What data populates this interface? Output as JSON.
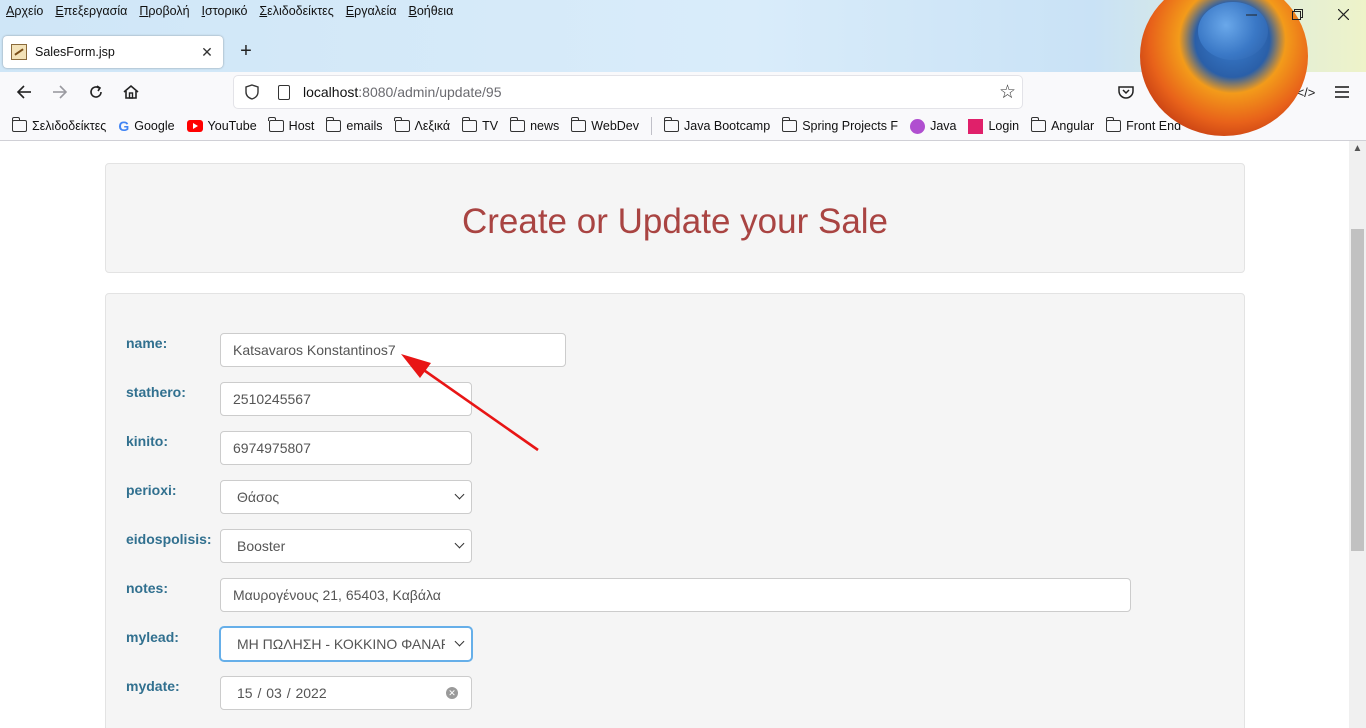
{
  "menubar": {
    "items": [
      "Αρχείο",
      "Επεξεργασία",
      "Προβολή",
      "Ιστορικό",
      "Σελιδοδείκτες",
      "Εργαλεία",
      "Βοήθεια"
    ]
  },
  "tab": {
    "title": "SalesForm.jsp",
    "close": "✕",
    "new_tab": "+"
  },
  "urlbar": {
    "host": "localhost",
    "rest": ":8080/admin/update/95"
  },
  "bookmarks": [
    {
      "label": "Σελιδοδείκτες",
      "icon": "folder-icon"
    },
    {
      "label": "Google",
      "icon": "google-icon"
    },
    {
      "label": "YouTube",
      "icon": "youtube-icon"
    },
    {
      "label": "Host",
      "icon": "folder-icon"
    },
    {
      "label": "emails",
      "icon": "folder-icon"
    },
    {
      "label": "Λεξικά",
      "icon": "folder-icon"
    },
    {
      "label": "TV",
      "icon": "folder-icon"
    },
    {
      "label": "news",
      "icon": "folder-icon"
    },
    {
      "label": "WebDev",
      "icon": "folder-icon"
    },
    {
      "label": "Java Bootcamp",
      "icon": "folder-icon"
    },
    {
      "label": "Spring Projects F",
      "icon": "folder-icon"
    },
    {
      "label": "Java",
      "icon": "java-icon"
    },
    {
      "label": "Login",
      "icon": "login-icon"
    },
    {
      "label": "Angular",
      "icon": "folder-icon"
    },
    {
      "label": "Front End",
      "icon": "folder-icon"
    }
  ],
  "page": {
    "title": "Create or Update your Sale",
    "form": {
      "name": {
        "label": "name:",
        "value": "Katsavaros Konstantinos7"
      },
      "stathero": {
        "label": "stathero:",
        "value": "2510245567"
      },
      "kinito": {
        "label": "kinito:",
        "value": "6974975807"
      },
      "perioxi": {
        "label": "perioxi:",
        "value": "Θάσος"
      },
      "eidospolisis": {
        "label": "eidospolisis:",
        "value": "Booster"
      },
      "notes": {
        "label": "notes:",
        "value": "Μαυρογένους 21, 65403, Καβάλα"
      },
      "mylead": {
        "label": "mylead:",
        "value": "ΜΗ ΠΩΛΗΣΗ - ΚΟΚΚΙΝΟ ΦΑΝΑΡΙ"
      },
      "mydate": {
        "label": "mydate:",
        "value": "15 / 03 / 2022"
      }
    }
  },
  "colors": {
    "title": "#a94442",
    "label": "#31708f",
    "annotation_arrow": "#e81515"
  }
}
